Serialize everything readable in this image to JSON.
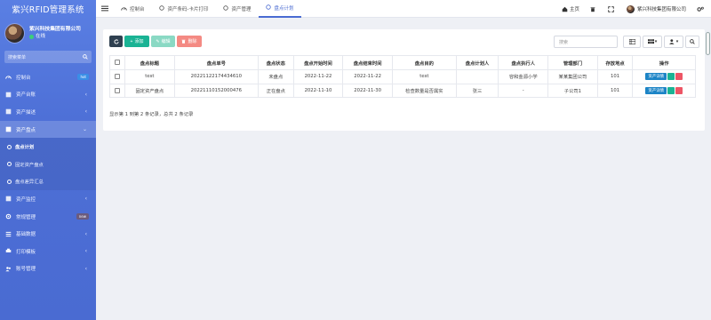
{
  "app": {
    "brand": "紫兴RFID管理系统"
  },
  "user": {
    "name": "紫兴科技集团有限公司",
    "status": "在线"
  },
  "sidebar": {
    "search_placeholder": "搜索菜单",
    "items": [
      {
        "label": "控制台",
        "icon": "dashboard-icon",
        "badge": "hot"
      },
      {
        "label": "资产台账",
        "icon": "ledger-icon",
        "chevron": "‹"
      },
      {
        "label": "资产描述",
        "icon": "desc-icon",
        "chevron": "‹"
      },
      {
        "label": "资产盘点",
        "icon": "inventory-icon",
        "chevron": "⌄",
        "active": true
      }
    ],
    "subitems": [
      {
        "label": "盘点计划",
        "current": true
      },
      {
        "label": "固定资产盘点"
      },
      {
        "label": "盘点差异汇总"
      }
    ],
    "items_after": [
      {
        "label": "资产监控",
        "icon": "monitor-icon",
        "chevron": "‹"
      },
      {
        "label": "常规管理",
        "icon": "gear-icon",
        "badge": "new"
      },
      {
        "label": "基础数据",
        "icon": "data-icon",
        "chevron": "‹"
      },
      {
        "label": "打印模板",
        "icon": "print-icon",
        "chevron": "‹"
      },
      {
        "label": "账号管理",
        "icon": "account-icon",
        "chevron": "‹"
      }
    ]
  },
  "topbar": {
    "tabs": [
      {
        "label": "控制台"
      },
      {
        "label": "资产条码-卡片打印"
      },
      {
        "label": "资产管理"
      },
      {
        "label": "盘点计划",
        "active": true
      }
    ],
    "home_label": "主页",
    "company_label": "紫兴科技集团有限公司"
  },
  "toolbar": {
    "add_label": "添加",
    "edit_label": "编辑",
    "delete_label": "删除",
    "search_placeholder": "搜索"
  },
  "table": {
    "columns": [
      "盘点标题",
      "盘点单号",
      "盘点状态",
      "盘点开始时间",
      "盘点结束时间",
      "盘点目的",
      "盘点计划人",
      "盘点执行人",
      "管理部门",
      "存放地点",
      "操作"
    ],
    "rows": [
      [
        "test",
        "20221122174434610",
        "未盘点",
        "2022-11-22",
        "2022-11-22",
        "test",
        "",
        "容和金源小学",
        "某某集团公司",
        "101"
      ],
      [
        "固定资产盘点",
        "20221110152000476",
        "正在盘点",
        "2022-11-10",
        "2022-11-30",
        "检查数量是否属实",
        "张三",
        "-",
        "子公司1",
        "101"
      ]
    ],
    "detail_label": "资产详情"
  },
  "summary": "显示第 1 到第 2 条记录，总共 2 条记录",
  "colors": {
    "sidebar": "#4a6bd2",
    "accent": "#4a6bd2",
    "add": "#1ab394",
    "delete": "#ed5565",
    "detail": "#1c84c6"
  }
}
